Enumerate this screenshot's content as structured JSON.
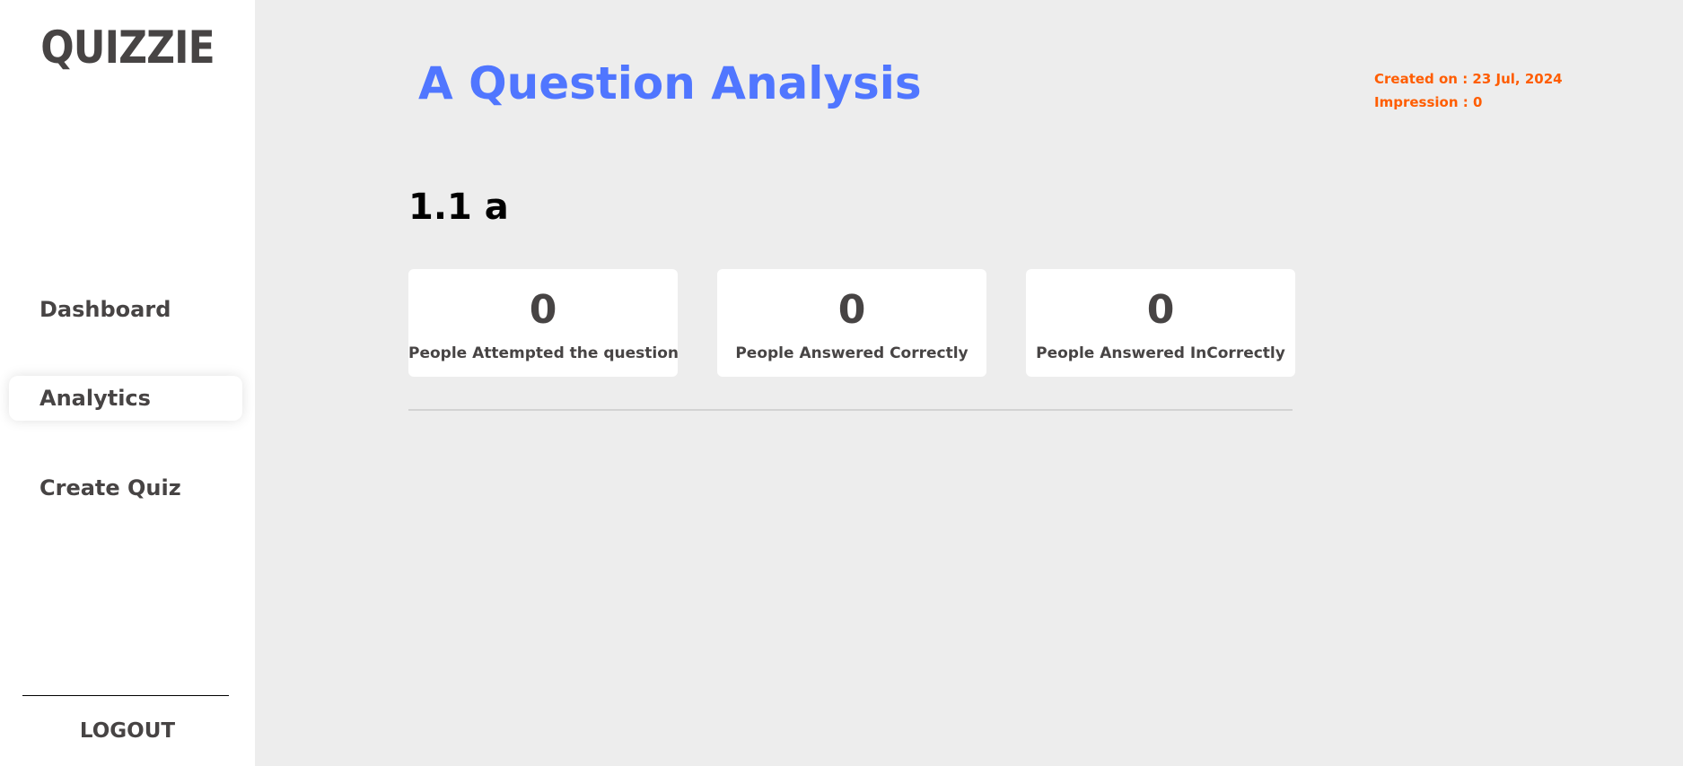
{
  "sidebar": {
    "logo": "QUIZZIE",
    "items": [
      {
        "label": "Dashboard"
      },
      {
        "label": "Analytics"
      },
      {
        "label": "Create Quiz"
      }
    ],
    "logout_label": "LOGOUT"
  },
  "main": {
    "title": "A Question Analysis",
    "created_on": "Created on : 23 Jul, 2024",
    "impression": "Impression : 0",
    "question": "1.1 a",
    "stats": [
      {
        "value": "0",
        "label": "People Attempted the question"
      },
      {
        "value": "0",
        "label": "People Answered Correctly"
      },
      {
        "value": "0",
        "label": "People Answered InCorrectly"
      }
    ]
  },
  "colors": {
    "title": "#5076ff",
    "meta": "#ff5d01",
    "text": "#474444",
    "background": "#ededed"
  }
}
